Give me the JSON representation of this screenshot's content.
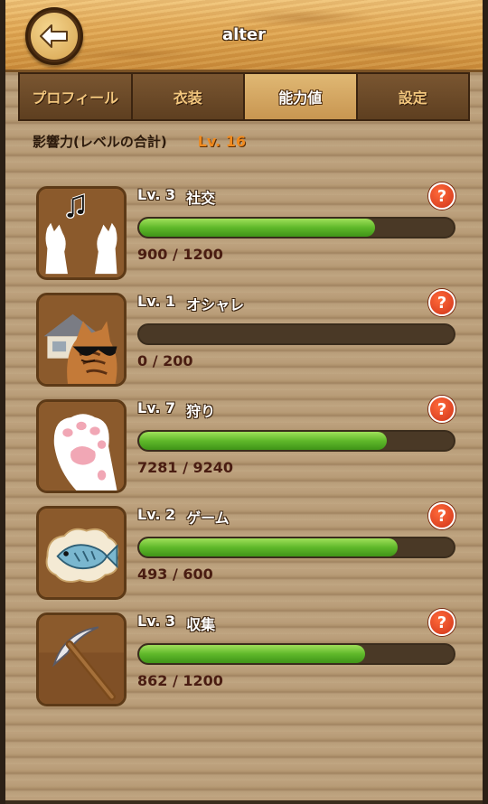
{
  "header": {
    "title": "alter"
  },
  "tabs": [
    {
      "label": "プロフィール",
      "active": false
    },
    {
      "label": "衣装",
      "active": false
    },
    {
      "label": "能力値",
      "active": true
    },
    {
      "label": "設定",
      "active": false
    }
  ],
  "influence": {
    "label": "影響力(レベルの合計)",
    "level": "Lv. 16"
  },
  "stats": [
    {
      "level": "Lv. 3",
      "name": "社交",
      "value": "900 / 1200",
      "progress": 0.75,
      "icon": "music-paws-icon"
    },
    {
      "level": "Lv. 1",
      "name": "オシャレ",
      "value": "0 / 200",
      "progress": 0.0,
      "icon": "sunglasses-cat-icon"
    },
    {
      "level": "Lv. 7",
      "name": "狩り",
      "value": "7281 / 9240",
      "progress": 0.788,
      "icon": "paw-icon"
    },
    {
      "level": "Lv. 2",
      "name": "ゲーム",
      "value": "493 / 600",
      "progress": 0.822,
      "icon": "fish-icon"
    },
    {
      "level": "Lv. 3",
      "name": "収集",
      "value": "862 / 1200",
      "progress": 0.718,
      "icon": "pickaxe-icon"
    }
  ],
  "help_symbol": "?",
  "colors": {
    "progress_fill": "#5fb82a",
    "accent_level": "#f08a1e",
    "help_button": "#d0341a"
  }
}
